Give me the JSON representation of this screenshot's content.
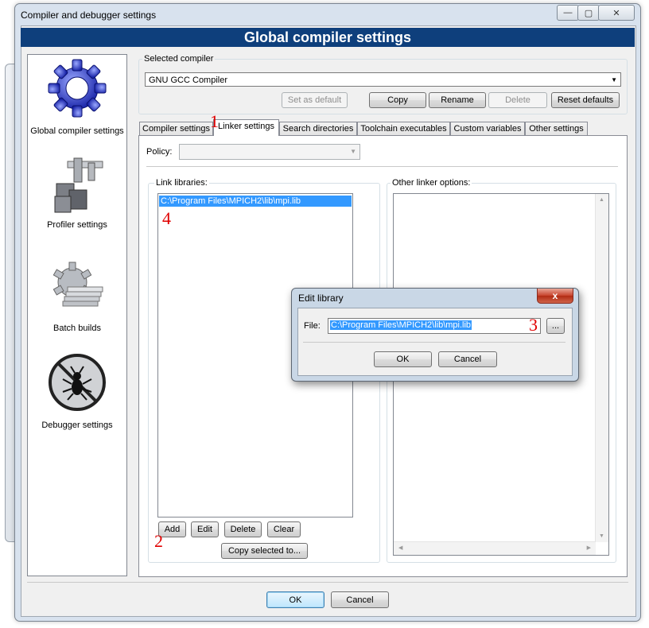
{
  "window": {
    "title": "Compiler and debugger settings",
    "minimize_glyph": "—",
    "maximize_glyph": "▢",
    "close_glyph": "✕"
  },
  "banner": {
    "title": "Global compiler settings"
  },
  "categories": [
    {
      "label": "Global compiler settings",
      "icon": "gear-icon"
    },
    {
      "label": "Profiler settings",
      "icon": "caliper-icon"
    },
    {
      "label": "Batch builds",
      "icon": "batch-gear-icon"
    },
    {
      "label": "Debugger settings",
      "icon": "bug-icon"
    }
  ],
  "selected_compiler": {
    "label": "Selected compiler",
    "value": "GNU GCC Compiler",
    "buttons": {
      "set_default": "Set as default",
      "copy": "Copy",
      "rename": "Rename",
      "delete": "Delete",
      "reset": "Reset defaults"
    }
  },
  "tabs": [
    "Compiler settings",
    "Linker settings",
    "Search directories",
    "Toolchain executables",
    "Custom variables",
    "Other settings"
  ],
  "active_tab": "Linker settings",
  "policy": {
    "label": "Policy:",
    "value": ""
  },
  "link_libraries": {
    "label": "Link libraries:",
    "items": [
      "C:\\Program Files\\MPICH2\\lib\\mpi.lib"
    ],
    "buttons": {
      "add": "Add",
      "edit": "Edit",
      "delete": "Delete",
      "clear": "Clear",
      "copy_to": "Copy selected to..."
    }
  },
  "other_linker": {
    "label": "Other linker options:",
    "value": ""
  },
  "footer": {
    "ok": "OK",
    "cancel": "Cancel"
  },
  "dialog": {
    "title": "Edit library",
    "close_glyph": "x",
    "file_label": "File:",
    "file_value": "C:\\Program Files\\MPICH2\\lib\\mpi.lib",
    "browse": "...",
    "ok": "OK",
    "cancel": "Cancel"
  },
  "annotations": [
    "1",
    "2",
    "3",
    "4"
  ],
  "colors": {
    "banner": "#0e3f7c",
    "selection": "#3399ff",
    "annotation": "#e00000"
  }
}
